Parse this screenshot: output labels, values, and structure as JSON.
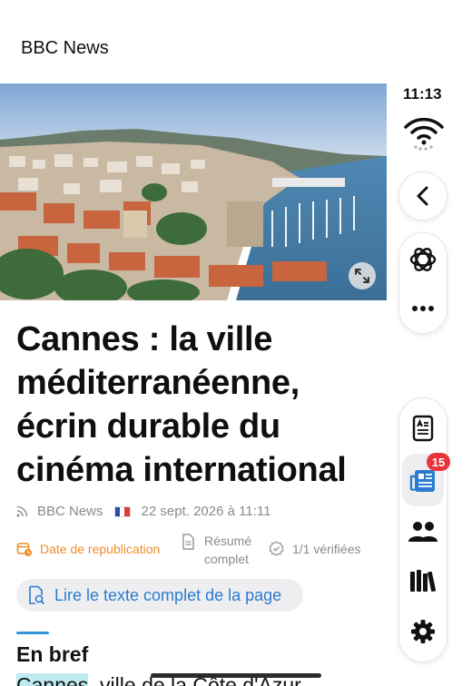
{
  "header": {
    "source_title": "BBC News"
  },
  "hero": {
    "alt_description": "photo-cannes-port"
  },
  "article": {
    "title": "Cannes : la ville méditerranéenne, écrin durable du cinéma international",
    "meta": {
      "source": "BBC News",
      "flag": "fr-flag",
      "date": "22 sept. 2026 à 11:11"
    },
    "badges": {
      "republication": "Date de republication",
      "summary_line1": "Résumé",
      "summary_line2": "complet",
      "verified": "1/1 vérifiées"
    },
    "read_full_label": "Lire le texte complet de la page",
    "section_title": "En bref",
    "body_highlight": "Cannes",
    "body_rest": ", ville de la Côte d'Azur"
  },
  "status": {
    "time": "11:13"
  },
  "rail": {
    "notification_count": "15",
    "icons": [
      "wifi-icon",
      "back-icon",
      "ai-icon",
      "more-icon",
      "reader-icon",
      "news-icon",
      "people-icon",
      "library-icon",
      "settings-icon"
    ]
  },
  "colors": {
    "accent_orange": "#ef8d2a",
    "accent_blue": "#2c7bd1",
    "badge_red": "#e8343a",
    "highlight": "#bfeaf0"
  }
}
